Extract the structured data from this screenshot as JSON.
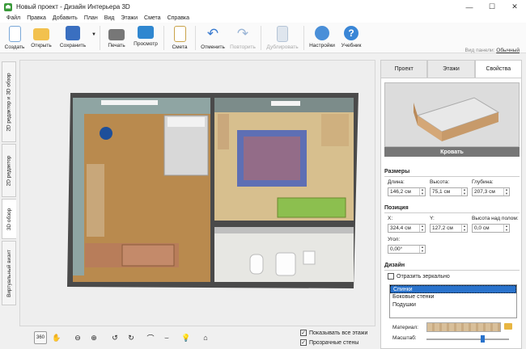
{
  "window": {
    "title": "Новый проект - Дизайн Интерьера 3D",
    "min": "—",
    "max": "☐",
    "close": "✕"
  },
  "menu": [
    "Файл",
    "Правка",
    "Добавить",
    "План",
    "Вид",
    "Этажи",
    "Смета",
    "Справка"
  ],
  "toolbar": [
    {
      "label": "Создать",
      "icon": "new-file-icon",
      "color": "#4a8fd8",
      "enabled": true
    },
    {
      "label": "Открыть",
      "icon": "folder-open-icon",
      "color": "#e8b642",
      "enabled": true
    },
    {
      "label": "Сохранить",
      "icon": "save-icon",
      "color": "#3a6fc0",
      "enabled": true
    },
    {
      "label": "Печать",
      "icon": "printer-icon",
      "color": "#666",
      "enabled": true
    },
    {
      "label": "Просмотр",
      "icon": "monitor-icon",
      "color": "#2f87d0",
      "enabled": true
    },
    {
      "label": "Смета",
      "icon": "estimate-icon",
      "color": "#c9a34a",
      "enabled": true
    },
    {
      "label": "Отменить",
      "icon": "undo-icon",
      "color": "#3a7bd0",
      "enabled": true
    },
    {
      "label": "Повторить",
      "icon": "redo-icon",
      "color": "#9ab5d6",
      "enabled": false
    },
    {
      "label": "Дублировать",
      "icon": "duplicate-icon",
      "color": "#b5c4d6",
      "enabled": false
    },
    {
      "label": "Настройки",
      "icon": "gear-icon",
      "color": "#4a8fd8",
      "enabled": true
    },
    {
      "label": "Учебник",
      "icon": "help-icon",
      "color": "#3a86d6",
      "enabled": true
    }
  ],
  "panel_view": {
    "label": "Вид панели:",
    "value": "Обычный"
  },
  "left_tabs": [
    "2D редактор и 3D обзор",
    "2D редактор",
    "3D обзор",
    "Виртуальный визит"
  ],
  "right_tabs": [
    "Проект",
    "Этажи",
    "Свойства"
  ],
  "properties": {
    "object_name": "Кровать",
    "size_section": "Размеры",
    "length_label": "Длина:",
    "length_value": "146,2 см",
    "height_label": "Высота:",
    "height_value": "75,1 см",
    "depth_label": "Глубина:",
    "depth_value": "207,3 см",
    "position_section": "Позиция",
    "x_label": "X:",
    "x_value": "324,4 см",
    "y_label": "Y:",
    "y_value": "127,2 см",
    "elev_label": "Высота над полом:",
    "elev_value": "0,0 см",
    "angle_label": "Угол:",
    "angle_value": "0,00°",
    "design_section": "Дизайн",
    "mirror_label": "Отразить зеркально",
    "parts": [
      "Спинки",
      "Боковые стенки",
      "Подушки"
    ],
    "material_label": "Материал:",
    "scale_label": "Масштаб:",
    "scale_level": 0.68
  },
  "bottom": {
    "show_all_floors": "Показывать все этажи",
    "transparent_walls": "Прозрачные стены",
    "buttons": [
      "rotate-360-icon",
      "pan-hand-icon",
      "zoom-out-icon",
      "zoom-in-icon",
      "rotate-left-icon",
      "rotate-right-icon",
      "tilt-up-icon",
      "tilt-down-icon",
      "light-bulb-icon",
      "home-icon"
    ]
  },
  "colors": {
    "accent": "#2a73cc",
    "selection": "#2a73cc"
  }
}
